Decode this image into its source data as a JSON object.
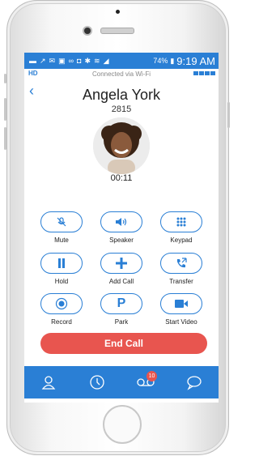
{
  "statusbar": {
    "battery": "74%",
    "time": "9:19 AM"
  },
  "call": {
    "hd_label": "HD",
    "connection": "Connected via Wi-Fi",
    "contact_name": "Angela York",
    "extension": "2815",
    "duration": "00:11"
  },
  "controls": [
    {
      "label": "Mute",
      "icon": "mute-icon"
    },
    {
      "label": "Speaker",
      "icon": "speaker-icon"
    },
    {
      "label": "Keypad",
      "icon": "keypad-icon"
    },
    {
      "label": "Hold",
      "icon": "pause-icon"
    },
    {
      "label": "Add Call",
      "icon": "plus-icon"
    },
    {
      "label": "Transfer",
      "icon": "transfer-icon"
    },
    {
      "label": "Record",
      "icon": "record-icon"
    },
    {
      "label": "Park",
      "icon": "park-icon"
    },
    {
      "label": "Start Video",
      "icon": "video-icon"
    }
  ],
  "end_call": {
    "label": "End Call"
  },
  "tabs": {
    "voicemail_badge": "10"
  },
  "colors": {
    "accent": "#2a7fd5",
    "end_call": "#e8554f"
  }
}
